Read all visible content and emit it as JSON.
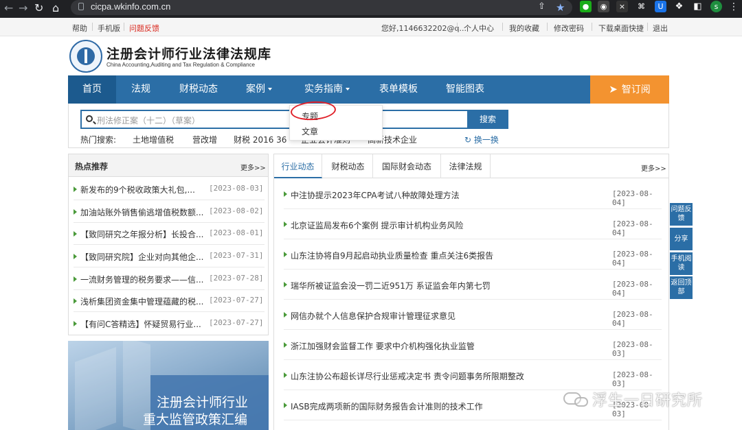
{
  "browser": {
    "url": "cicpa.wkinfo.com.cn",
    "avatar_letter": "s"
  },
  "topbar": {
    "left": [
      "帮助",
      "手机版",
      "问题反馈"
    ],
    "greeting": "您好,1146632202@q...",
    "right": [
      "个人中心",
      "我的收藏",
      "修改密码",
      "下载桌面快捷",
      "退出"
    ]
  },
  "logo": {
    "title": "注册会计师行业法律法规库",
    "subtitle": "China Accounting,Auditing and Tax Regulation & Compliance"
  },
  "nav": {
    "items": [
      "首页",
      "法规",
      "财税动态",
      "案例",
      "实务指南",
      "表单模板",
      "智能图表"
    ],
    "subscribe": "智订阅"
  },
  "dropdown": {
    "items": [
      "专题",
      "文章"
    ]
  },
  "search": {
    "placeholder": "刑法修正案（十二）（草案）",
    "button": "搜索",
    "hot_label": "热门搜索:",
    "hot_terms": [
      "土地增值税",
      "营改增",
      "财税 2016 36",
      "企业会计准则",
      "高新技术企业"
    ],
    "refresh": "换一换"
  },
  "hot": {
    "title": "热点推荐",
    "more": "更多>>",
    "items": [
      {
        "title": "新发布的9个税收政策大礼包,...",
        "date": "[2023-08-03]"
      },
      {
        "title": "加油站账外销售偷逃增值税数额...",
        "date": "[2023-08-02]"
      },
      {
        "title": "【致同研究之年报分析】长投合...",
        "date": "[2023-08-01]"
      },
      {
        "title": "【致同研究院】企业对向其他企...",
        "date": "[2023-07-31]"
      },
      {
        "title": "一流财务管理的税务要求——信...",
        "date": "[2023-07-28]"
      },
      {
        "title": "浅析集团资金集中管理蕴藏的税...",
        "date": "[2023-07-27]"
      },
      {
        "title": "【有问C答精选】怀疑贸易行业...",
        "date": "[2023-07-27]"
      }
    ]
  },
  "banner": {
    "line1": "注册会计师行业",
    "line2": "重大监管政策汇编"
  },
  "news": {
    "tabs": [
      "行业动态",
      "财税动态",
      "国际财会动态",
      "法律法规"
    ],
    "more": "更多>>",
    "items": [
      {
        "title": "中注协提示2023年CPA考试八种故障处理方法",
        "date": "[2023-08-04]"
      },
      {
        "title": "北京证监局发布6个案例 提示审计机构业务风险",
        "date": "[2023-08-04]"
      },
      {
        "title": "山东注协将自9月起启动执业质量检查 重点关注6类报告",
        "date": "[2023-08-04]"
      },
      {
        "title": "瑞华所被证监会没一罚二近951万 系证监会年内第七罚",
        "date": "[2023-08-04]"
      },
      {
        "title": "网信办就个人信息保护合规审计管理征求意见",
        "date": "[2023-08-04]"
      },
      {
        "title": "浙江加强财会监督工作 要求中介机构强化执业监管",
        "date": "[2023-08-03]"
      },
      {
        "title": "山东注协公布超长详尽行业惩戒决定书 责令问题事务所限期整改",
        "date": "[2023-08-03]"
      },
      {
        "title": "IASB完成两项新的国际财务报告会计准则的技术工作",
        "date": "[2023-08-03]"
      }
    ]
  },
  "float": [
    "问题反馈",
    "分享",
    "手机阅读",
    "返回顶部"
  ],
  "watermark": "浮生一日研究所",
  "colors": {
    "nav_blue": "#2b6ea6",
    "subscribe_orange": "#f39330",
    "annotation_red": "#e0212a"
  }
}
